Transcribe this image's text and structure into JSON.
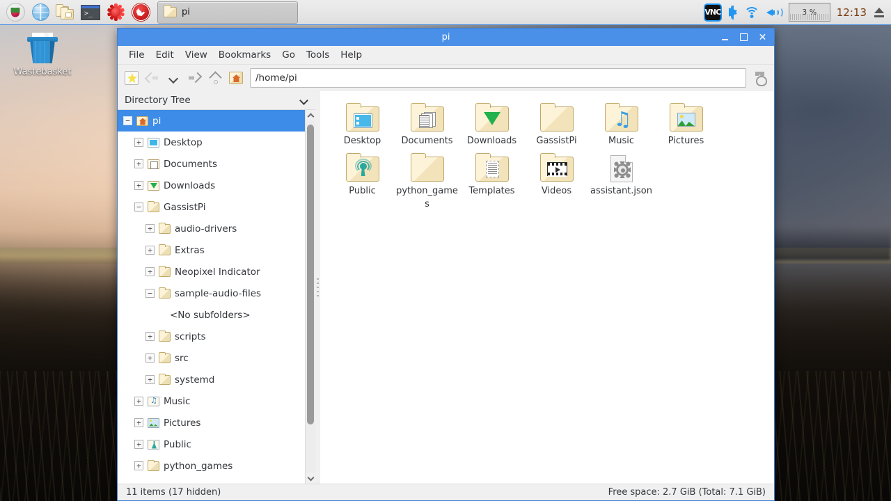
{
  "taskbar": {
    "launchers": [
      {
        "name": "raspberry-menu-icon",
        "label": "Menu"
      },
      {
        "name": "web-browser-icon",
        "label": "Web Browser"
      },
      {
        "name": "file-manager-icon",
        "label": "File Manager"
      },
      {
        "name": "terminal-icon",
        "label": "Terminal"
      },
      {
        "name": "mathematica-icon",
        "label": "Mathematica"
      },
      {
        "name": "wolfram-icon",
        "label": "Wolfram"
      }
    ],
    "window_button": {
      "label": "pi",
      "icon": "folder-icon"
    },
    "tray": {
      "vnc_label": "VNC",
      "bluetooth_icon": "bluetooth-icon",
      "wifi_icon": "wifi-icon",
      "volume_icon": "volume-icon",
      "cpu_label": "3 %",
      "clock": "12:13",
      "eject_icon": "eject-icon"
    }
  },
  "desktop": {
    "wastebasket_label": "Wastebasket"
  },
  "window": {
    "title": "pi",
    "controls": {
      "minimize": "minimize",
      "maximize": "maximize",
      "close": "close"
    },
    "menus": [
      "File",
      "Edit",
      "View",
      "Bookmarks",
      "Go",
      "Tools",
      "Help"
    ],
    "toolbar": {
      "bookmark": "bookmark-icon",
      "back": "back-icon",
      "history_dropdown": "chevron-down-icon",
      "forward": "forward-icon",
      "up": "up-icon",
      "home": "home-icon",
      "paw": "paw-icon"
    },
    "path": "/home/pi",
    "path_placeholder": "/home/pi"
  },
  "sidebar": {
    "header": "Directory Tree",
    "tree": [
      {
        "label": "pi",
        "indent": 0,
        "expander": "minus",
        "icon": "t-home",
        "selected": true
      },
      {
        "label": "Desktop",
        "indent": 1,
        "expander": "plus",
        "icon": "t-desktop",
        "selected": false
      },
      {
        "label": "Documents",
        "indent": 1,
        "expander": "plus",
        "icon": "t-docs",
        "selected": false
      },
      {
        "label": "Downloads",
        "indent": 1,
        "expander": "plus",
        "icon": "t-dl",
        "selected": false
      },
      {
        "label": "GassistPi",
        "indent": 1,
        "expander": "minus",
        "icon": "t-folder",
        "selected": false
      },
      {
        "label": "audio-drivers",
        "indent": 2,
        "expander": "plus",
        "icon": "t-folder",
        "selected": false
      },
      {
        "label": "Extras",
        "indent": 2,
        "expander": "plus",
        "icon": "t-folder",
        "selected": false
      },
      {
        "label": "Neopixel Indicator",
        "indent": 2,
        "expander": "plus",
        "icon": "t-folder",
        "selected": false
      },
      {
        "label": "sample-audio-files",
        "indent": 2,
        "expander": "minus",
        "icon": "t-folder",
        "selected": false
      },
      {
        "label": "<No subfolders>",
        "indent": 3,
        "expander": "none",
        "icon": "none",
        "selected": false
      },
      {
        "label": "scripts",
        "indent": 2,
        "expander": "plus",
        "icon": "t-folder",
        "selected": false
      },
      {
        "label": "src",
        "indent": 2,
        "expander": "plus",
        "icon": "t-folder",
        "selected": false
      },
      {
        "label": "systemd",
        "indent": 2,
        "expander": "plus",
        "icon": "t-folder",
        "selected": false
      },
      {
        "label": "Music",
        "indent": 1,
        "expander": "plus",
        "icon": "t-music",
        "selected": false
      },
      {
        "label": "Pictures",
        "indent": 1,
        "expander": "plus",
        "icon": "t-pics",
        "selected": false
      },
      {
        "label": "Public",
        "indent": 1,
        "expander": "plus",
        "icon": "t-public",
        "selected": false
      },
      {
        "label": "python_games",
        "indent": 1,
        "expander": "plus",
        "icon": "t-folder",
        "selected": false
      }
    ]
  },
  "files": [
    {
      "label": "Desktop",
      "kind": "folder",
      "overlay": "ov-desktop"
    },
    {
      "label": "Documents",
      "kind": "folder",
      "overlay": "ov-doc"
    },
    {
      "label": "Downloads",
      "kind": "folder",
      "overlay": "ov-dl"
    },
    {
      "label": "GassistPi",
      "kind": "folder",
      "overlay": "none"
    },
    {
      "label": "Music",
      "kind": "folder",
      "overlay": "ov-music"
    },
    {
      "label": "Pictures",
      "kind": "folder",
      "overlay": "ov-pic"
    },
    {
      "label": "Public",
      "kind": "folder",
      "overlay": "ov-public"
    },
    {
      "label": "python_games",
      "kind": "folder",
      "overlay": "none"
    },
    {
      "label": "Templates",
      "kind": "folder",
      "overlay": "ov-tpl"
    },
    {
      "label": "Videos",
      "kind": "folder",
      "overlay": "ov-vid"
    },
    {
      "label": "assistant.json",
      "kind": "file",
      "overlay": "json"
    }
  ],
  "statusbar": {
    "items": "11 items (17 hidden)",
    "free_space": "Free space: 2.7 GiB (Total: 7.1 GiB)"
  },
  "colors": {
    "titlebar": "#4a90e8",
    "selection": "#3d8ce8",
    "tray_accent": "#2196f3",
    "clock": "#7a3b0f"
  }
}
